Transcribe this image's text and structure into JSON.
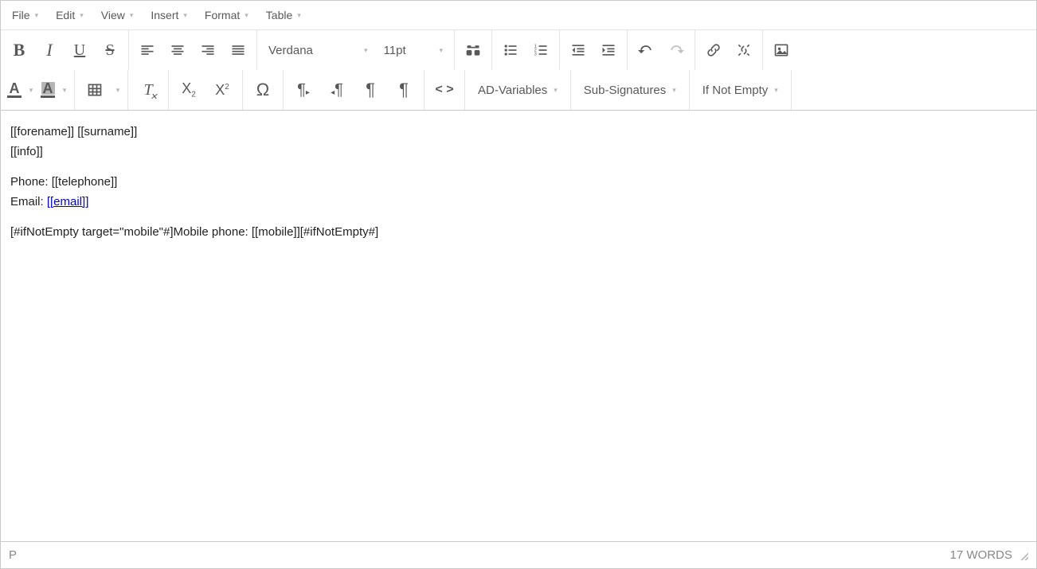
{
  "menubar": {
    "file": "File",
    "edit": "Edit",
    "view": "View",
    "insert": "Insert",
    "format": "Format",
    "table": "Table"
  },
  "toolbar": {
    "font_family": "Verdana",
    "font_size": "11pt",
    "ad_variables": "AD-Variables",
    "sub_signatures": "Sub-Signatures",
    "if_not_empty": "If Not Empty"
  },
  "content": {
    "line1": "[[forename]] [[surname]]",
    "line2": "[[info]]",
    "line3_label": "Phone: ",
    "line3_value": "[[telephone]]",
    "line4_label": "Email: ",
    "line4_link": "[[email]]",
    "line5": "[#ifNotEmpty target=\"mobile\"#]Mobile phone: [[mobile]][#ifNotEmpty#]"
  },
  "status": {
    "path": "P",
    "words": "17 WORDS"
  }
}
